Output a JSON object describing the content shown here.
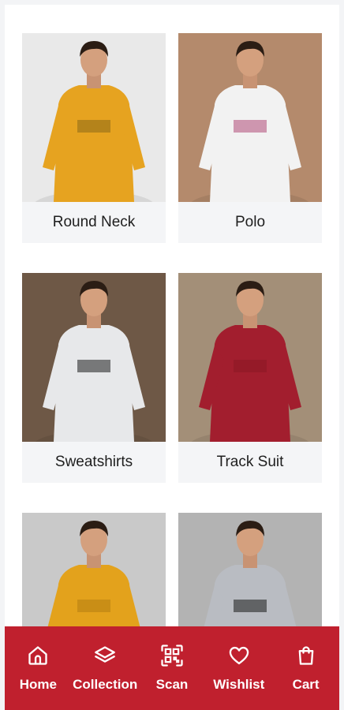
{
  "categories": [
    {
      "label": "Round Neck",
      "bg": "#e9e9e9",
      "shirt": "#e6a320",
      "accent": "#8a6a18"
    },
    {
      "label": "Polo",
      "bg": "#b48a6c",
      "shirt": "#f2f2f2",
      "accent": "#b04a78"
    },
    {
      "label": "Sweatshirts",
      "bg": "#6e5846",
      "shirt": "#e7e8ea",
      "accent": "#1c1c1c"
    },
    {
      "label": "Track Suit",
      "bg": "#a38f78",
      "shirt": "#a21e2e",
      "accent": "#8a1724"
    },
    {
      "label": "",
      "bg": "#c9c9c9",
      "shirt": "#e3a21c",
      "accent": "#b57e12"
    },
    {
      "label": "",
      "bg": "#b3b3b3",
      "shirt": "#b9bcc2",
      "accent": "#1a1a1a"
    }
  ],
  "bottom_nav": {
    "color": "#c0202e",
    "items": [
      {
        "label": "Home",
        "icon": "home-icon"
      },
      {
        "label": "Collection",
        "icon": "layers-icon"
      },
      {
        "label": "Scan",
        "icon": "qr-scan-icon"
      },
      {
        "label": "Wishlist",
        "icon": "heart-icon"
      },
      {
        "label": "Cart",
        "icon": "shopping-bag-icon"
      }
    ]
  }
}
